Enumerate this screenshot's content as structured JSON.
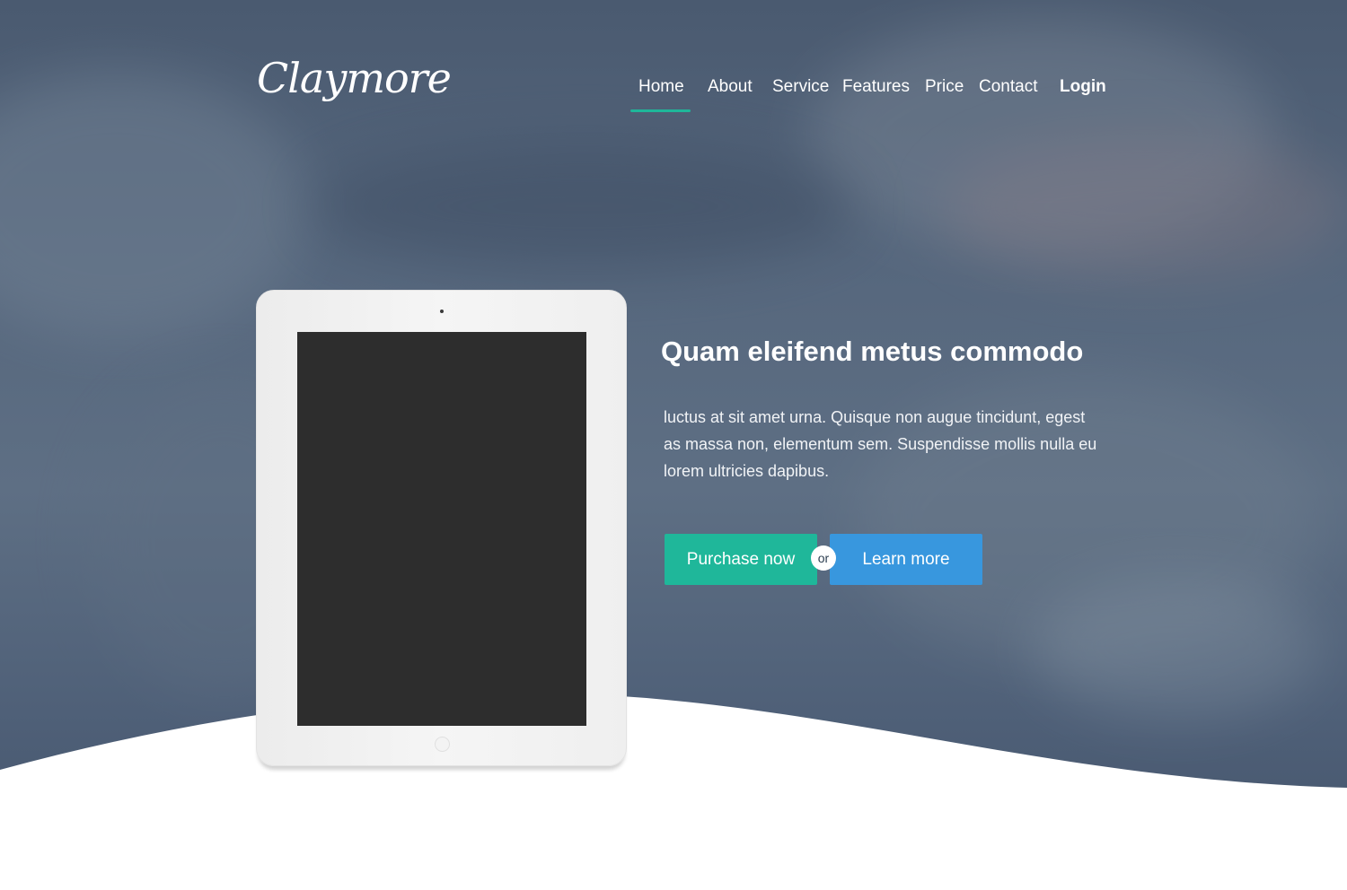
{
  "brand": {
    "logo_text": "Claymore"
  },
  "nav": {
    "items": [
      {
        "label": "Home",
        "active": true
      },
      {
        "label": "About"
      },
      {
        "label": "Service"
      },
      {
        "label": "Features"
      },
      {
        "label": "Price"
      },
      {
        "label": "Contact"
      }
    ],
    "login_label": "Login"
  },
  "hero": {
    "headline": "Quam eleifend metus commodo",
    "body": "luctus at sit amet urna. Quisque non augue tincidunt, egest as massa non, elementum sem. Suspendisse mollis nulla eu lorem ultricies dapibus.",
    "primary_button": "Purchase now",
    "separator": "or",
    "secondary_button": "Learn more"
  },
  "colors": {
    "accent_green": "#1fb79a",
    "accent_blue": "#3897de",
    "hero_overlay": "#55667c"
  }
}
